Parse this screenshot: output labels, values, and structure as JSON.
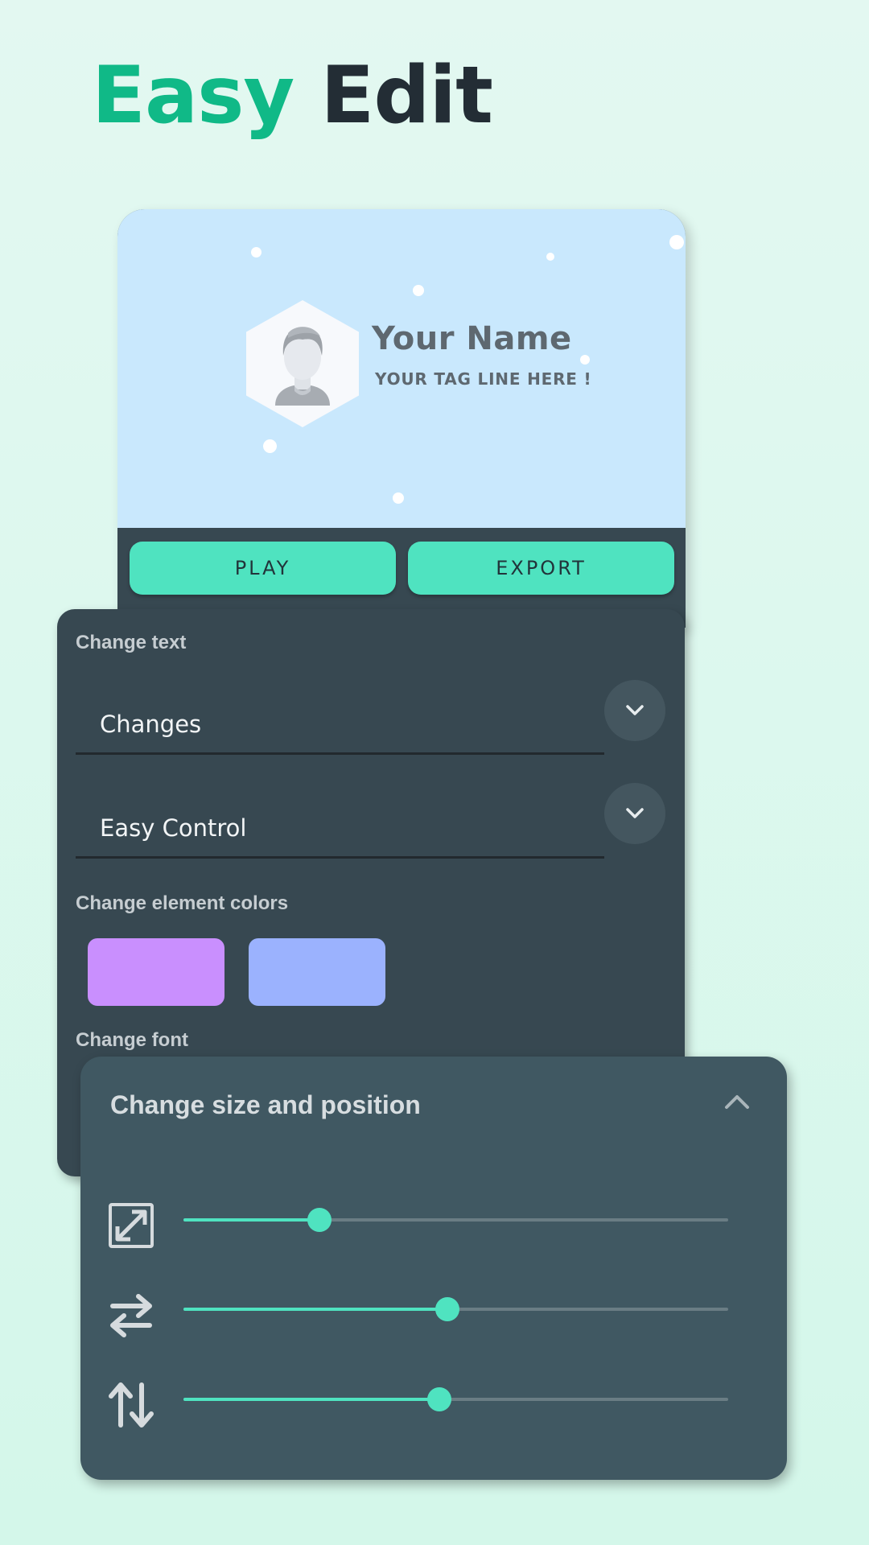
{
  "headline": {
    "accent": "Easy",
    "rest": "Edit"
  },
  "preview": {
    "name": "Your Name",
    "tagline": "YOUR TAG LINE HERE !"
  },
  "buttons": {
    "play": "PLAY",
    "export": "EXPORT"
  },
  "text_panel": {
    "change_text_label": "Change text",
    "fields": [
      {
        "value": "Changes",
        "icon": "chevron-down-icon"
      },
      {
        "value": "Easy Control",
        "icon": "chevron-down-icon"
      }
    ],
    "colors_label": "Change element colors",
    "swatches": [
      "#c98ffe",
      "#9bb2fe"
    ],
    "font_label": "Change font"
  },
  "size_panel": {
    "title": "Change size and position",
    "collapse_icon": "chevron-up-icon",
    "sliders": [
      {
        "icon": "resize-icon",
        "level": 0.25
      },
      {
        "icon": "horizontal-swap-icon",
        "level": 0.485
      },
      {
        "icon": "vertical-swap-icon",
        "level": 0.47
      }
    ]
  },
  "colors": {
    "accent": "#10b987",
    "button": "#4fe3c0",
    "panel": "#374851",
    "panel_light": "#405862"
  }
}
